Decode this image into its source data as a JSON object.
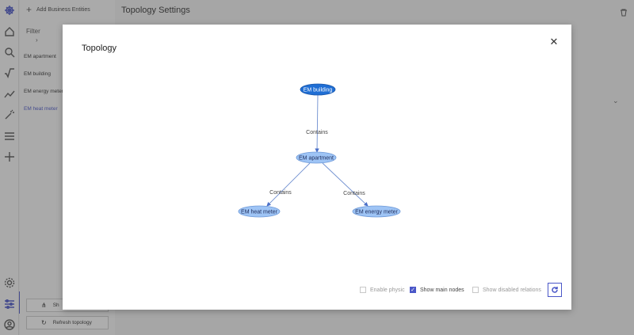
{
  "sidebar": {
    "add_entities_label": "Add Business Entities",
    "filter_label": "Filter",
    "entities": [
      {
        "label": "EM apartment"
      },
      {
        "label": "EM building"
      },
      {
        "label": "EM energy meter"
      },
      {
        "label": "EM heat meter",
        "active": true
      }
    ],
    "show_button_label": "Sh",
    "refresh_topology_label": "Refresh topology"
  },
  "main": {
    "title": "Topology Settings"
  },
  "modal": {
    "title": "Topology",
    "close_icon": "close-icon",
    "graph": {
      "nodes": [
        {
          "id": "building",
          "label": "EM building",
          "main": true
        },
        {
          "id": "apartment",
          "label": "EM apartment"
        },
        {
          "id": "heat",
          "label": "EM heat meter"
        },
        {
          "id": "energy",
          "label": "EM energy meter"
        }
      ],
      "edges": [
        {
          "from": "building",
          "to": "apartment",
          "label": "Contains"
        },
        {
          "from": "apartment",
          "to": "heat",
          "label": "Contains"
        },
        {
          "from": "apartment",
          "to": "energy",
          "label": "Contains"
        }
      ],
      "colors": {
        "main_node": "#1f6ed4",
        "node": "#9ec4f5",
        "edge": "#6f8fd0"
      }
    },
    "options": {
      "enable_physic": {
        "label": "Enable physic",
        "checked": false
      },
      "show_main_nodes": {
        "label": "Show main nodes",
        "checked": true
      },
      "show_disabled_relations": {
        "label": "Show disabled relations",
        "checked": false
      }
    }
  },
  "colors": {
    "accent": "#4a57c8"
  }
}
